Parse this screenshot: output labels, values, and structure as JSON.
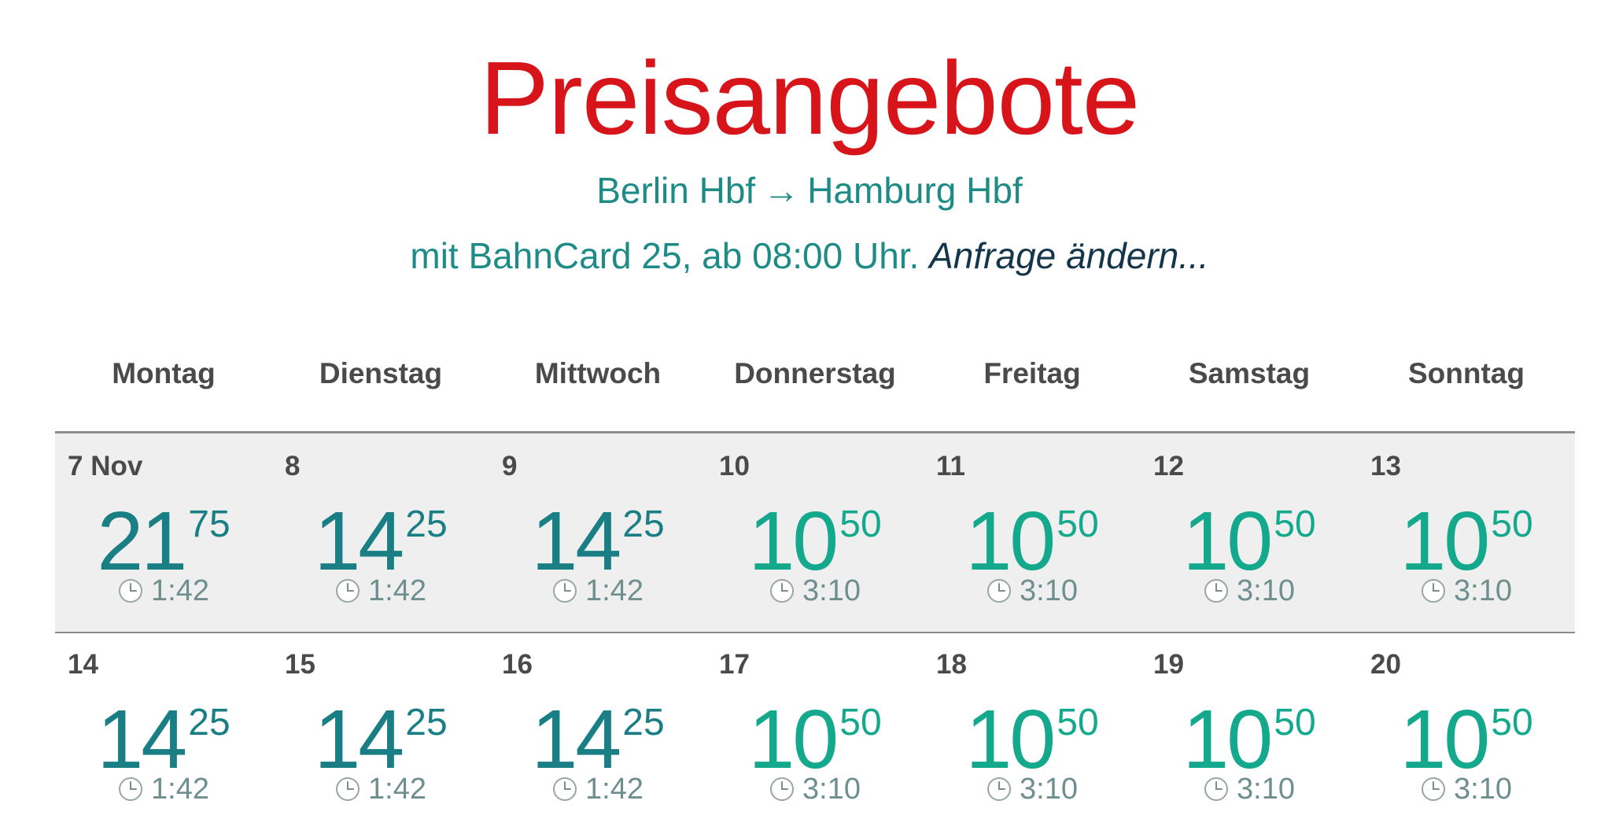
{
  "header": {
    "title": "Preisangebote",
    "route_from": "Berlin Hbf",
    "route_arrow": "→",
    "route_to": "Hamburg Hbf",
    "conditions": "mit BahnCard 25, ab 08:00 Uhr.",
    "change_link": "Anfrage ändern..."
  },
  "colors": {
    "title": "#d8141b",
    "route_text": "#1f8b87",
    "link": "#15354a",
    "price_normal": "#1a7f84",
    "price_cheap": "#14a88d",
    "duration_text": "#6f8f8f",
    "week_shade": "#efefef"
  },
  "weekdays": [
    "Montag",
    "Dienstag",
    "Mittwoch",
    "Donnerstag",
    "Freitag",
    "Samstag",
    "Sonntag"
  ],
  "weeks": [
    {
      "days": [
        {
          "date": "7 Nov",
          "euros": "21",
          "cents": "75",
          "duration": "1:42",
          "tier": "normal",
          "icon": "clock-icon"
        },
        {
          "date": "8",
          "euros": "14",
          "cents": "25",
          "duration": "1:42",
          "tier": "normal",
          "icon": "clock-icon"
        },
        {
          "date": "9",
          "euros": "14",
          "cents": "25",
          "duration": "1:42",
          "tier": "normal",
          "icon": "clock-icon"
        },
        {
          "date": "10",
          "euros": "10",
          "cents": "50",
          "duration": "3:10",
          "tier": "cheap",
          "icon": "clock-icon"
        },
        {
          "date": "11",
          "euros": "10",
          "cents": "50",
          "duration": "3:10",
          "tier": "cheap",
          "icon": "clock-icon"
        },
        {
          "date": "12",
          "euros": "10",
          "cents": "50",
          "duration": "3:10",
          "tier": "cheap",
          "icon": "clock-icon"
        },
        {
          "date": "13",
          "euros": "10",
          "cents": "50",
          "duration": "3:10",
          "tier": "cheap",
          "icon": "clock-icon"
        }
      ]
    },
    {
      "days": [
        {
          "date": "14",
          "euros": "14",
          "cents": "25",
          "duration": "1:42",
          "tier": "normal",
          "icon": "clock-icon"
        },
        {
          "date": "15",
          "euros": "14",
          "cents": "25",
          "duration": "1:42",
          "tier": "normal",
          "icon": "clock-icon"
        },
        {
          "date": "16",
          "euros": "14",
          "cents": "25",
          "duration": "1:42",
          "tier": "normal",
          "icon": "clock-icon"
        },
        {
          "date": "17",
          "euros": "10",
          "cents": "50",
          "duration": "3:10",
          "tier": "cheap",
          "icon": "clock-icon"
        },
        {
          "date": "18",
          "euros": "10",
          "cents": "50",
          "duration": "3:10",
          "tier": "cheap",
          "icon": "clock-icon"
        },
        {
          "date": "19",
          "euros": "10",
          "cents": "50",
          "duration": "3:10",
          "tier": "cheap",
          "icon": "clock-icon"
        },
        {
          "date": "20",
          "euros": "10",
          "cents": "50",
          "duration": "3:10",
          "tier": "cheap",
          "icon": "clock-icon"
        }
      ]
    }
  ]
}
